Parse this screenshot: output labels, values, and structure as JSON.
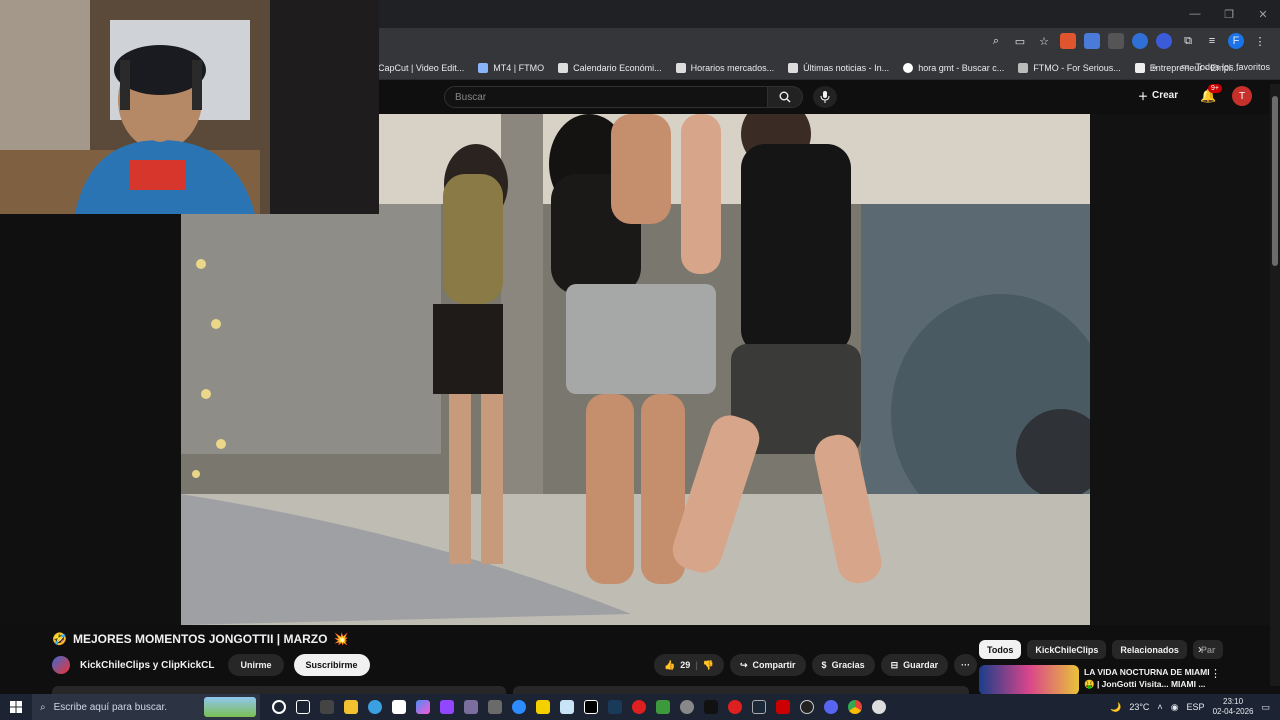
{
  "window": {
    "minimize": "—",
    "restore": "❐",
    "close": "✕"
  },
  "bookmarks": [
    "CapCut | Video Edit...",
    "MT4 | FTMO",
    "Calendario Económi...",
    "Horarios mercados...",
    "Últimas noticias - In...",
    "hora gmt - Buscar c...",
    "FTMO - For Serious...",
    "Entrepreneur - Empi..."
  ],
  "bookmarks_overflow": "»",
  "bookmarks_all": "Todos los favoritos",
  "header": {
    "search_placeholder": "Buscar",
    "create_label": "Crear",
    "notification_badge": "9+",
    "avatar_letter": "T"
  },
  "video": {
    "title": "MEJORES MOMENTOS JONGOTTII | MARZO",
    "title_emoji_left": "🤣",
    "title_emoji_right": "💥",
    "channel": "KickChileClips y ClipKickCL",
    "join_label": "Unirme",
    "subscribe_label": "Suscribirme",
    "likes": "29",
    "share_label": "Compartir",
    "thanks_label": "Gracias",
    "save_label": "Guardar",
    "more_label": "···"
  },
  "sidebar": {
    "chips": [
      "Todos",
      "KickChileClips",
      "Relacionados",
      "Par"
    ],
    "recommendation": {
      "title": "LA VIDA NOCTURNA DE MIAMI 🤑 | JonGotti Visita... MIAMI ..."
    }
  },
  "taskbar": {
    "search_placeholder": "Escribe aquí para buscar.",
    "weather": "23°C",
    "language": "ESP",
    "time": "23:10",
    "date": "02-04-2026"
  },
  "colors": {
    "youtube_bg": "#0f0f0f",
    "chip_active": "#f1f1f1",
    "avatar": "#c6322b",
    "taskbar": "#1c2433"
  }
}
